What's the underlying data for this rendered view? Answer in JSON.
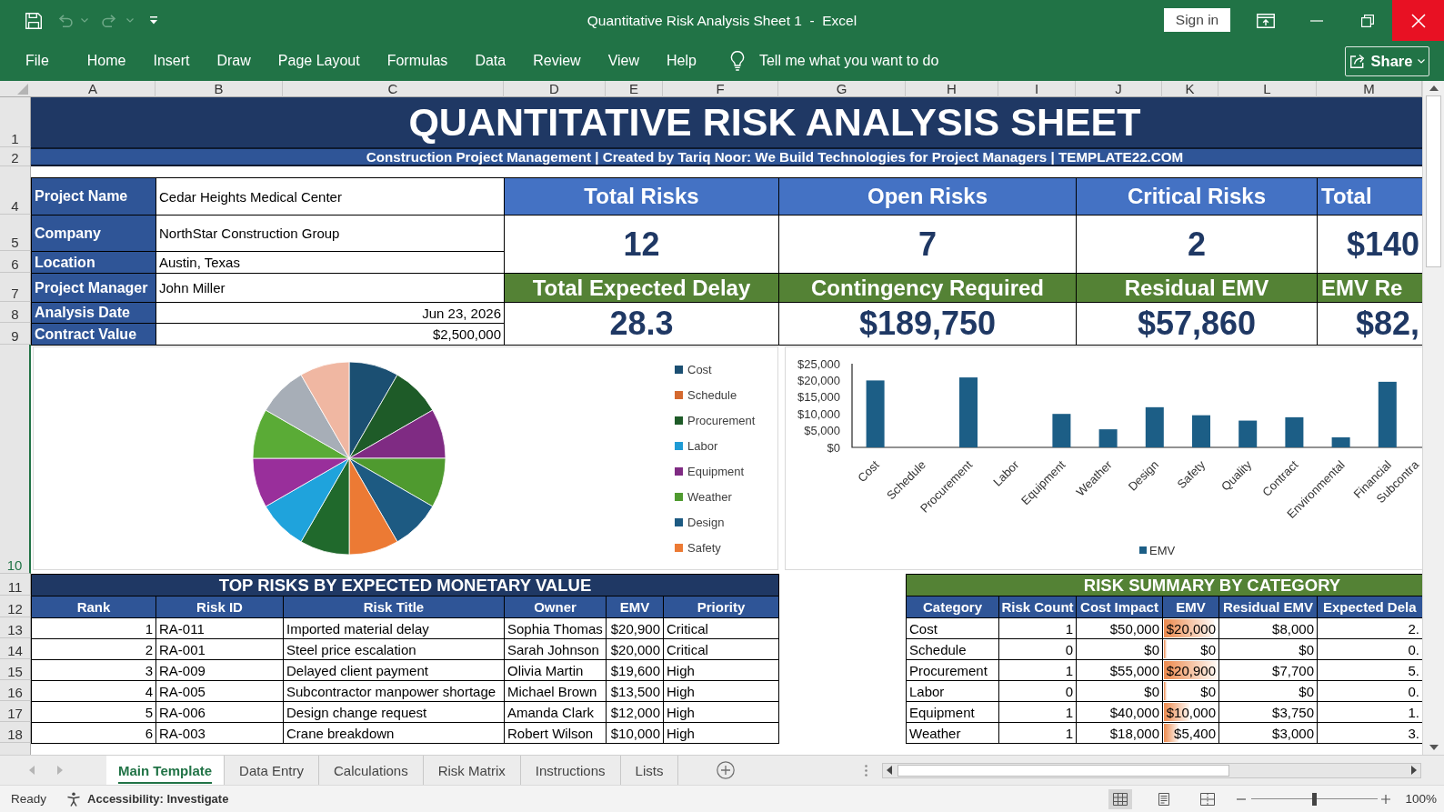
{
  "window": {
    "title": "Quantitative Risk Analysis Sheet 1  -  Excel",
    "sign_in": "Sign in"
  },
  "ribbon": {
    "tabs": [
      {
        "label": "File",
        "selected": false
      },
      {
        "label": "Home",
        "selected": false
      },
      {
        "label": "Insert",
        "selected": false
      },
      {
        "label": "Draw",
        "selected": false
      },
      {
        "label": "Page Layout",
        "selected": false
      },
      {
        "label": "Formulas",
        "selected": false
      },
      {
        "label": "Data",
        "selected": false
      },
      {
        "label": "Review",
        "selected": false
      },
      {
        "label": "View",
        "selected": false
      },
      {
        "label": "Help",
        "selected": false
      }
    ],
    "tell_me": "Tell me what you want to do",
    "share": "Share"
  },
  "column_headers": [
    "A",
    "B",
    "C",
    "D",
    "E",
    "F",
    "G",
    "H",
    "I",
    "J",
    "K",
    "L",
    "M"
  ],
  "row_headers": [
    {
      "label": "1",
      "selected": false
    },
    {
      "label": "2",
      "selected": false
    },
    {
      "label": "4",
      "selected": false
    },
    {
      "label": "5",
      "selected": false
    },
    {
      "label": "6",
      "selected": false
    },
    {
      "label": "7",
      "selected": false
    },
    {
      "label": "8",
      "selected": false
    },
    {
      "label": "9",
      "selected": false
    },
    {
      "label": "10",
      "selected": true
    },
    {
      "label": "11",
      "selected": false
    },
    {
      "label": "12",
      "selected": false
    },
    {
      "label": "13",
      "selected": false
    },
    {
      "label": "14",
      "selected": false
    },
    {
      "label": "15",
      "selected": false
    },
    {
      "label": "16",
      "selected": false
    },
    {
      "label": "17",
      "selected": false
    },
    {
      "label": "18",
      "selected": false
    }
  ],
  "sheet": {
    "title": "QUANTITATIVE RISK ANALYSIS SHEET",
    "subtitle": "Construction Project Management | Created by Tariq Noor: We Build Technologies for Project Managers | TEMPLATE22.COM",
    "project_info": [
      {
        "label": "Project Name",
        "value": "Cedar Heights Medical Center",
        "kind": "text"
      },
      {
        "label": "Company",
        "value": "NorthStar Construction Group",
        "kind": "text"
      },
      {
        "label": "Location",
        "value": "Austin, Texas",
        "kind": "text"
      },
      {
        "label": "Project Manager",
        "value": "John Miller",
        "kind": "text"
      },
      {
        "label": "Analysis Date",
        "value": "Jun 23, 2026",
        "kind": "date"
      },
      {
        "label": "Contract Value",
        "value": "$2,500,000",
        "kind": "number"
      }
    ],
    "kpis": [
      {
        "label": "Total Risks",
        "value": "12"
      },
      {
        "label": "Open Risks",
        "value": "7"
      },
      {
        "label": "Critical Risks",
        "value": "2"
      },
      {
        "label": "Total",
        "value": "$140"
      }
    ],
    "kpis_secondary": [
      {
        "label": "Total Expected Delay",
        "value": "28.3"
      },
      {
        "label": "Contingency Required",
        "value": "$189,750"
      },
      {
        "label": "Residual EMV",
        "value": "$57,860"
      },
      {
        "label": "EMV Re",
        "value": "$82,"
      }
    ],
    "pie_chart": {
      "legend": [
        {
          "label": "Cost",
          "color": "#1b4f72"
        },
        {
          "label": "Schedule",
          "color": "#d4692f"
        },
        {
          "label": "Procurement",
          "color": "#1e5b28"
        },
        {
          "label": "Labor",
          "color": "#1f9bd5"
        },
        {
          "label": "Equipment",
          "color": "#7f2b83"
        },
        {
          "label": "Weather",
          "color": "#4f9a2f"
        },
        {
          "label": "Design",
          "color": "#1d5a82"
        },
        {
          "label": "Safety",
          "color": "#ec7a34"
        }
      ]
    },
    "bar_chart": {
      "chart_data": {
        "type": "bar",
        "categories": [
          "Cost",
          "Schedule",
          "Procurement",
          "Labor",
          "Equipment",
          "Weather",
          "Design",
          "Safety",
          "Quality",
          "Contract",
          "Environmental",
          "Financial",
          "Subcontra"
        ],
        "series": [
          {
            "name": "EMV",
            "color": "#1c5e86",
            "values": [
              20000,
              0,
              20900,
              0,
              10000,
              5400,
              12000,
              9600,
              8000,
              9000,
              3000,
              19600,
              null
            ]
          }
        ],
        "ylim": [
          0,
          25000
        ],
        "yticks": [
          {
            "value": 0,
            "label": "$0"
          },
          {
            "value": 5000,
            "label": "$5,000"
          },
          {
            "value": 10000,
            "label": "$10,000"
          },
          {
            "value": 15000,
            "label": "$15,000"
          },
          {
            "value": 20000,
            "label": "$20,000"
          },
          {
            "value": 25000,
            "label": "$25,000"
          }
        ],
        "legend": "bottom"
      }
    },
    "top_risks": {
      "title": "TOP RISKS BY EXPECTED MONETARY VALUE",
      "columns": [
        {
          "label": "Rank",
          "kind": "number"
        },
        {
          "label": "Risk ID",
          "kind": "text"
        },
        {
          "label": "Risk Title",
          "kind": "text"
        },
        {
          "label": "Owner",
          "kind": "text"
        },
        {
          "label": "EMV",
          "kind": "number"
        },
        {
          "label": "Priority",
          "kind": "text"
        }
      ],
      "rows": [
        [
          "1",
          "RA-011",
          "Imported material delay",
          "Sophia Thomas",
          "$20,900",
          "Critical"
        ],
        [
          "2",
          "RA-001",
          "Steel price escalation",
          "Sarah Johnson",
          "$20,000",
          "Critical"
        ],
        [
          "3",
          "RA-009",
          "Delayed client payment",
          "Olivia Martin",
          "$19,600",
          "High"
        ],
        [
          "4",
          "RA-005",
          "Subcontractor manpower shortage",
          "Michael Brown",
          "$13,500",
          "High"
        ],
        [
          "5",
          "RA-006",
          "Design change request",
          "Amanda Clark",
          "$12,000",
          "High"
        ],
        [
          "6",
          "RA-003",
          "Crane breakdown",
          "Robert Wilson",
          "$10,000",
          "High"
        ]
      ]
    },
    "risk_summary": {
      "title": "RISK SUMMARY BY CATEGORY",
      "columns": [
        {
          "label": "Category",
          "kind": "text"
        },
        {
          "label": "Risk Count",
          "kind": "number"
        },
        {
          "label": "Cost Impact",
          "kind": "number"
        },
        {
          "label": "EMV",
          "kind": "bar"
        },
        {
          "label": "Residual EMV",
          "kind": "number"
        },
        {
          "label": "Expected Dela",
          "kind": "number"
        }
      ],
      "rows": [
        {
          "cells": [
            "Cost",
            "1",
            "$50,000",
            "$20,000",
            "$8,000",
            "2."
          ],
          "level": 0.95
        },
        {
          "cells": [
            "Schedule",
            "0",
            "$0",
            "$0",
            "$0",
            "0."
          ],
          "level": 0.05
        },
        {
          "cells": [
            "Procurement",
            "1",
            "$55,000",
            "$20,900",
            "$7,700",
            "5."
          ],
          "level": 1
        },
        {
          "cells": [
            "Labor",
            "0",
            "$0",
            "$0",
            "$0",
            "0."
          ],
          "level": 0.05
        },
        {
          "cells": [
            "Equipment",
            "1",
            "$40,000",
            "$10,000",
            "$3,750",
            "1."
          ],
          "level": 0.48
        },
        {
          "cells": [
            "Weather",
            "1",
            "$18,000",
            "$5,400",
            "$3,000",
            "3."
          ],
          "level": 0.27
        }
      ]
    }
  },
  "sheet_tabs": [
    {
      "label": "Main Template",
      "selected": true
    },
    {
      "label": "Data Entry",
      "selected": false
    },
    {
      "label": "Calculations",
      "selected": false
    },
    {
      "label": "Risk Matrix",
      "selected": false
    },
    {
      "label": "Instructions",
      "selected": false
    },
    {
      "label": "Lists",
      "selected": false
    }
  ],
  "status_bar": {
    "mode": "Ready",
    "accessibility": "Accessibility: Investigate",
    "views": [
      {
        "kind": "normal",
        "selected": true
      },
      {
        "kind": "page_layout",
        "selected": false
      },
      {
        "kind": "page_break",
        "selected": false
      }
    ],
    "zoom_slider": {
      "level": 0.5
    },
    "zoom": "100%"
  }
}
